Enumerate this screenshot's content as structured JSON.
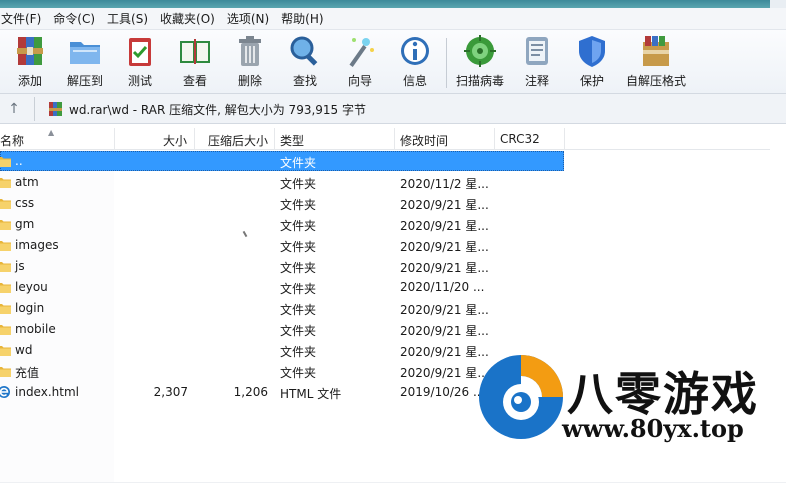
{
  "menu": [
    "文件(F)",
    "命令(C)",
    "工具(S)",
    "收藏夹(O)",
    "选项(N)",
    "帮助(H)"
  ],
  "toolbar": {
    "add": "添加",
    "extract": "解压到",
    "test": "测试",
    "view": "查看",
    "delete": "删除",
    "find": "查找",
    "wizard": "向导",
    "info": "信息",
    "virus": "扫描病毒",
    "comment": "注释",
    "protect": "保护",
    "sfx": "自解压格式"
  },
  "address": {
    "path": "wd.rar\\wd - RAR 压缩文件, 解包大小为 793,915 字节"
  },
  "columns": {
    "name": "名称",
    "size": "大小",
    "packed": "压缩后大小",
    "type": "类型",
    "modified": "修改时间",
    "crc": "CRC32"
  },
  "rows": [
    {
      "name": "..",
      "size": "",
      "packed": "",
      "type": "文件夹",
      "date": "",
      "selected": true,
      "icon": "folder-icon"
    },
    {
      "name": "atm",
      "size": "",
      "packed": "",
      "type": "文件夹",
      "date": "2020/11/2 星...",
      "icon": "folder-icon"
    },
    {
      "name": "css",
      "size": "",
      "packed": "",
      "type": "文件夹",
      "date": "2020/9/21 星...",
      "icon": "folder-icon"
    },
    {
      "name": "gm",
      "size": "",
      "packed": "",
      "type": "文件夹",
      "date": "2020/9/21 星...",
      "icon": "folder-icon"
    },
    {
      "name": "images",
      "size": "",
      "packed": "",
      "type": "文件夹",
      "date": "2020/9/21 星...",
      "icon": "folder-icon"
    },
    {
      "name": "js",
      "size": "",
      "packed": "",
      "type": "文件夹",
      "date": "2020/9/21 星...",
      "icon": "folder-icon"
    },
    {
      "name": "leyou",
      "size": "",
      "packed": "",
      "type": "文件夹",
      "date": "2020/11/20 ...",
      "icon": "folder-icon"
    },
    {
      "name": "login",
      "size": "",
      "packed": "",
      "type": "文件夹",
      "date": "2020/9/21 星...",
      "icon": "folder-icon"
    },
    {
      "name": "mobile",
      "size": "",
      "packed": "",
      "type": "文件夹",
      "date": "2020/9/21 星...",
      "icon": "folder-icon"
    },
    {
      "name": "wd",
      "size": "",
      "packed": "",
      "type": "文件夹",
      "date": "2020/9/21 星...",
      "icon": "folder-icon"
    },
    {
      "name": "充值",
      "size": "",
      "packed": "",
      "type": "文件夹",
      "date": "2020/9/21 星...",
      "icon": "folder-icon"
    },
    {
      "name": "index.html",
      "size": "2,307",
      "packed": "1,206",
      "type": "HTML 文件",
      "date": "2019/10/26 ...",
      "icon": "html-file-icon"
    }
  ],
  "watermark": {
    "brand": "八零游戏",
    "url": "www.80yx.top"
  },
  "colors": {
    "selection": "#3399ff",
    "folder": "#f2c94c",
    "watermark_blue": "#1a73c8",
    "watermark_orange": "#f39c12"
  }
}
